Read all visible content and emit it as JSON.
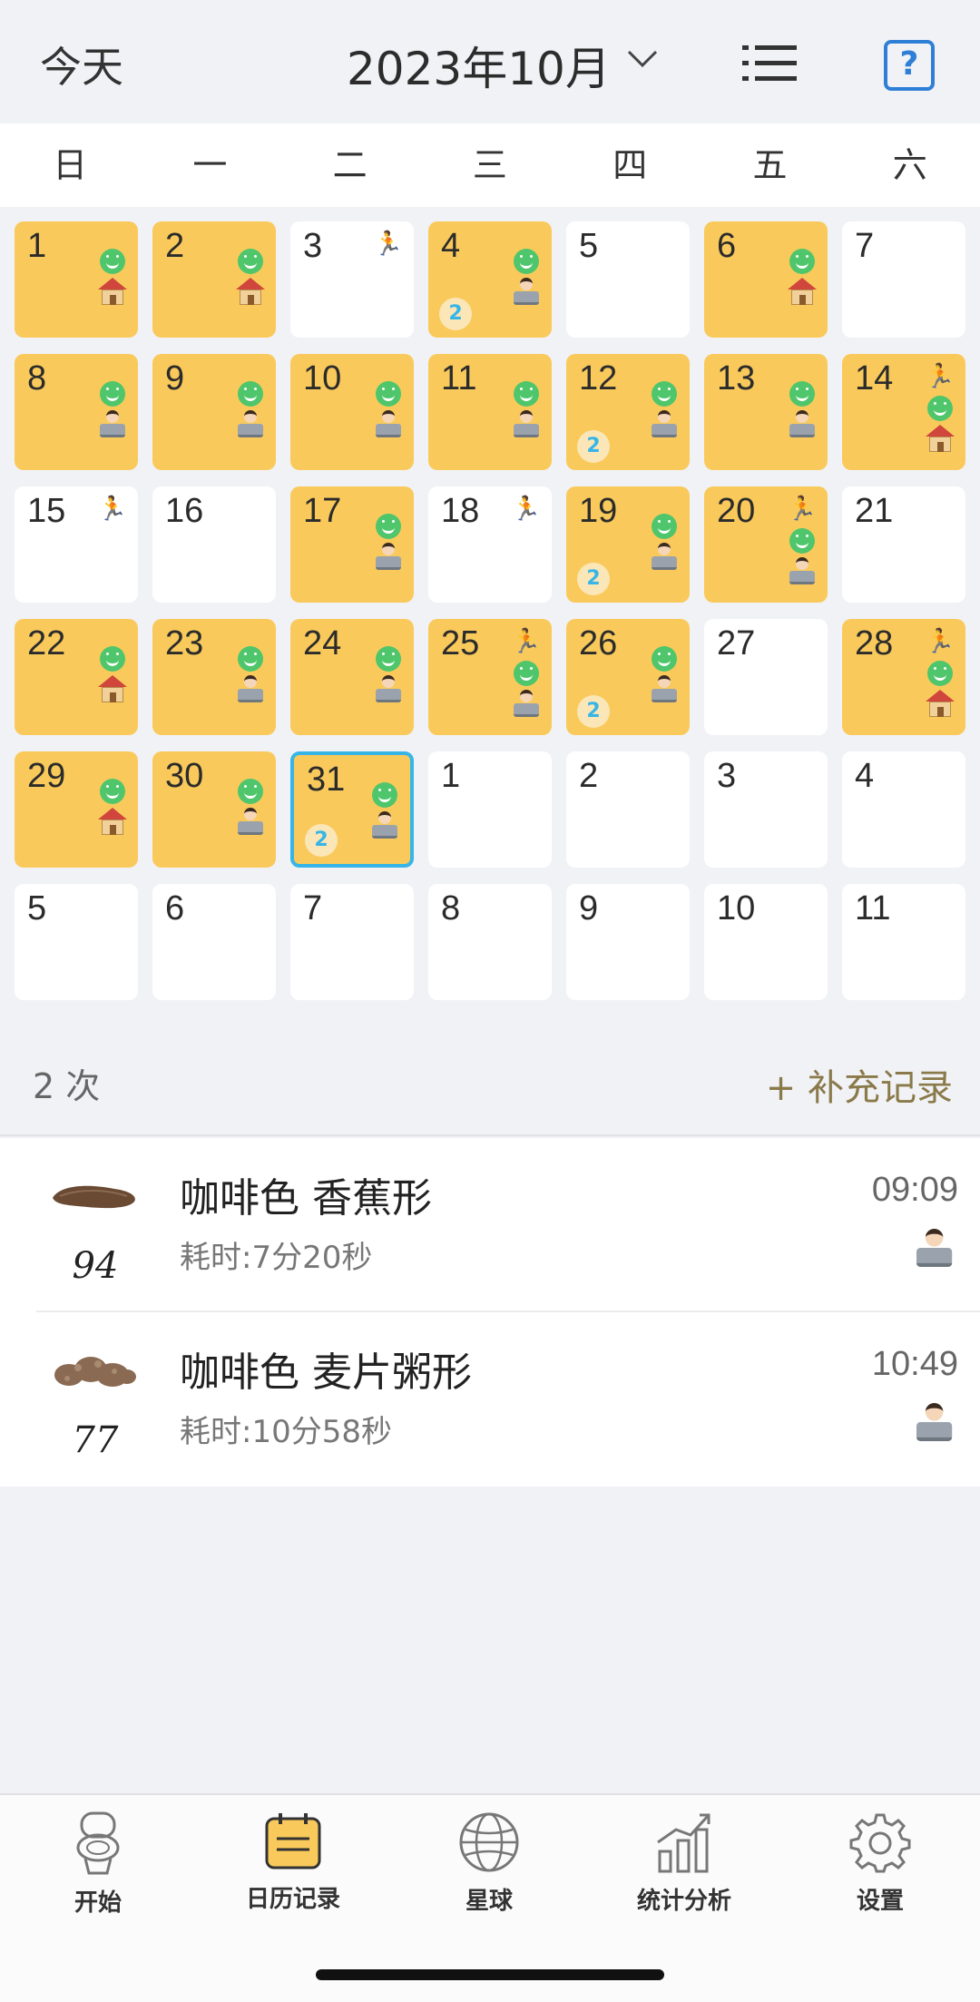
{
  "header": {
    "today_label": "今天",
    "month_label": "2023年10月"
  },
  "weekdays": [
    "日",
    "一",
    "二",
    "三",
    "四",
    "五",
    "六"
  ],
  "calendar": [
    {
      "day": "1",
      "yellow": true,
      "icons": [
        "smile",
        "house"
      ]
    },
    {
      "day": "2",
      "yellow": true,
      "icons": [
        "smile",
        "house"
      ]
    },
    {
      "day": "3",
      "yellow": false,
      "icons": [
        "runner"
      ]
    },
    {
      "day": "4",
      "yellow": true,
      "icons": [
        "smile",
        "worker"
      ],
      "badge": "2"
    },
    {
      "day": "5",
      "yellow": false,
      "icons": []
    },
    {
      "day": "6",
      "yellow": true,
      "icons": [
        "smile",
        "house"
      ]
    },
    {
      "day": "7",
      "yellow": false,
      "icons": []
    },
    {
      "day": "8",
      "yellow": true,
      "icons": [
        "smile",
        "worker"
      ]
    },
    {
      "day": "9",
      "yellow": true,
      "icons": [
        "smile",
        "worker"
      ]
    },
    {
      "day": "10",
      "yellow": true,
      "icons": [
        "smile",
        "worker"
      ]
    },
    {
      "day": "11",
      "yellow": true,
      "icons": [
        "smile",
        "worker"
      ]
    },
    {
      "day": "12",
      "yellow": true,
      "icons": [
        "smile",
        "worker"
      ],
      "badge": "2"
    },
    {
      "day": "13",
      "yellow": true,
      "icons": [
        "smile",
        "worker"
      ]
    },
    {
      "day": "14",
      "yellow": true,
      "icons": [
        "runner",
        "smile",
        "house"
      ]
    },
    {
      "day": "15",
      "yellow": false,
      "icons": [
        "runner"
      ]
    },
    {
      "day": "16",
      "yellow": false,
      "icons": []
    },
    {
      "day": "17",
      "yellow": true,
      "icons": [
        "smile",
        "worker"
      ]
    },
    {
      "day": "18",
      "yellow": false,
      "icons": [
        "runner"
      ]
    },
    {
      "day": "19",
      "yellow": true,
      "icons": [
        "smile",
        "worker"
      ],
      "badge": "2"
    },
    {
      "day": "20",
      "yellow": true,
      "icons": [
        "runner",
        "smile",
        "worker"
      ]
    },
    {
      "day": "21",
      "yellow": false,
      "icons": []
    },
    {
      "day": "22",
      "yellow": true,
      "icons": [
        "smile",
        "house"
      ]
    },
    {
      "day": "23",
      "yellow": true,
      "icons": [
        "smile",
        "worker"
      ]
    },
    {
      "day": "24",
      "yellow": true,
      "icons": [
        "smile",
        "worker"
      ]
    },
    {
      "day": "25",
      "yellow": true,
      "icons": [
        "runner",
        "smile",
        "worker"
      ]
    },
    {
      "day": "26",
      "yellow": true,
      "icons": [
        "smile",
        "worker"
      ],
      "badge": "2"
    },
    {
      "day": "27",
      "yellow": false,
      "icons": []
    },
    {
      "day": "28",
      "yellow": true,
      "icons": [
        "runner",
        "smile",
        "house"
      ]
    },
    {
      "day": "29",
      "yellow": true,
      "icons": [
        "smile",
        "house"
      ]
    },
    {
      "day": "30",
      "yellow": true,
      "icons": [
        "smile",
        "worker"
      ]
    },
    {
      "day": "31",
      "yellow": true,
      "icons": [
        "smile",
        "worker"
      ],
      "badge": "2",
      "selected": true
    },
    {
      "day": "1",
      "yellow": false,
      "icons": []
    },
    {
      "day": "2",
      "yellow": false,
      "icons": []
    },
    {
      "day": "3",
      "yellow": false,
      "icons": []
    },
    {
      "day": "4",
      "yellow": false,
      "icons": []
    },
    {
      "day": "5",
      "yellow": false,
      "icons": []
    },
    {
      "day": "6",
      "yellow": false,
      "icons": []
    },
    {
      "day": "7",
      "yellow": false,
      "icons": []
    },
    {
      "day": "8",
      "yellow": false,
      "icons": []
    },
    {
      "day": "9",
      "yellow": false,
      "icons": []
    },
    {
      "day": "10",
      "yellow": false,
      "icons": []
    },
    {
      "day": "11",
      "yellow": false,
      "icons": []
    }
  ],
  "summary": {
    "count_label": "2 次",
    "add_label": "+ 补充记录"
  },
  "records": [
    {
      "title": "咖啡色 香蕉形",
      "duration": "耗时:7分20秒",
      "score": "94",
      "time": "09:09",
      "shape": "banana"
    },
    {
      "title": "咖啡色 麦片粥形",
      "duration": "耗时:10分58秒",
      "score": "77",
      "time": "10:49",
      "shape": "mushy"
    }
  ],
  "tabs": [
    {
      "label": "开始",
      "icon": "toilet-icon"
    },
    {
      "label": "日历记录",
      "icon": "calendar-icon"
    },
    {
      "label": "星球",
      "icon": "globe-icon"
    },
    {
      "label": "统计分析",
      "icon": "chart-icon"
    },
    {
      "label": "设置",
      "icon": "gear-icon"
    }
  ],
  "colors": {
    "accent_yellow": "#f9ca5b",
    "selected_border": "#37b5e6",
    "smile_green": "#4fc66b",
    "help_blue": "#2f7fd6"
  }
}
